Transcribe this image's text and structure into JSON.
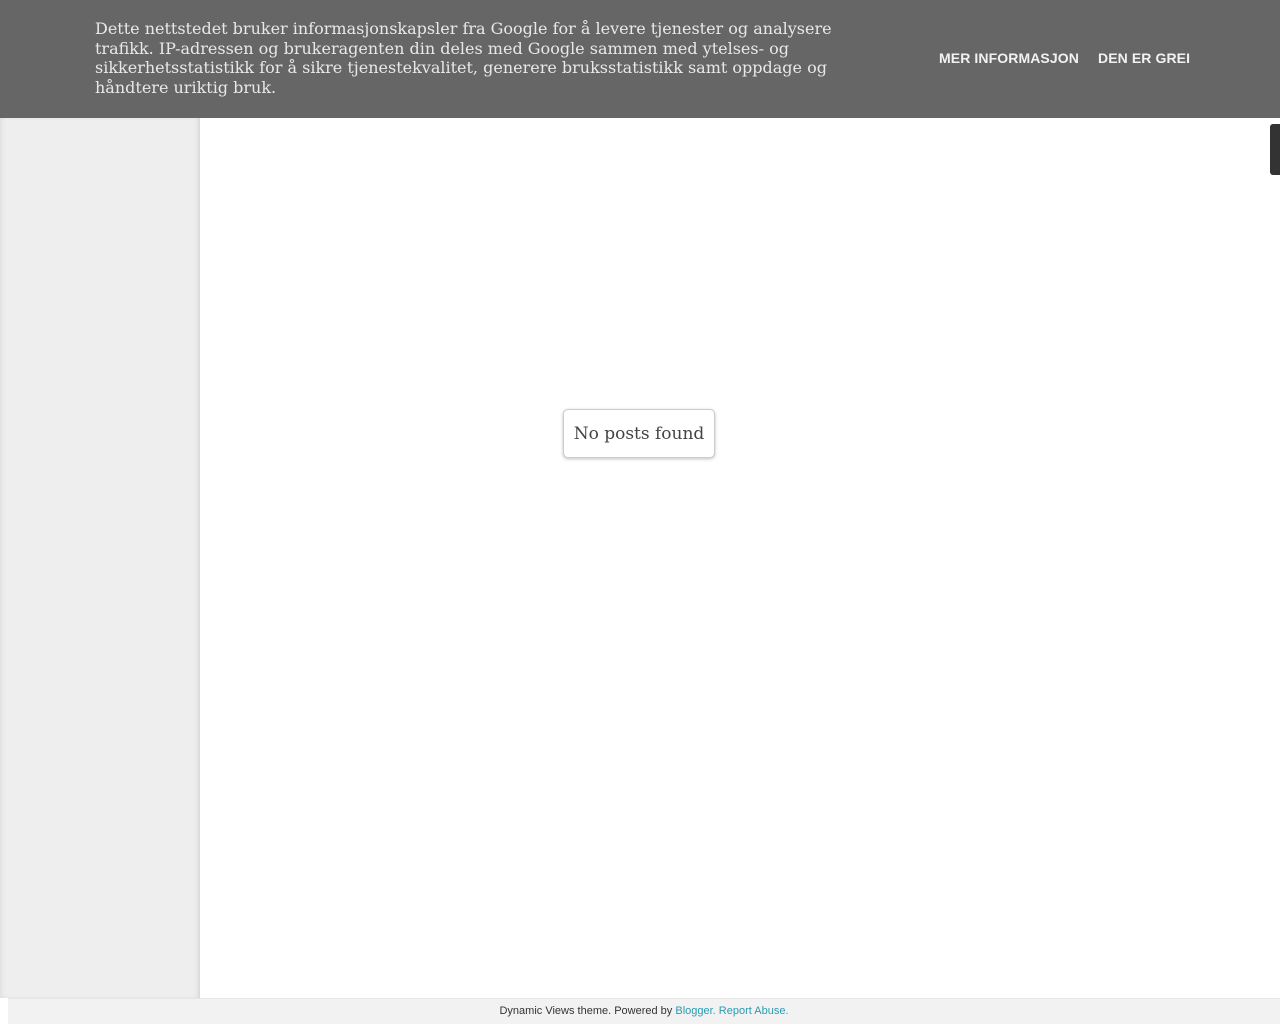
{
  "cookie_banner": {
    "message": "Dette nettstedet bruker informasjonskapsler fra Google for å levere tjenester og analysere trafikk. IP-adressen og brukeragenten din deles med Google sammen med ytelses- og sikkerhetsstatistikk for å sikre tjenestekvalitet, generere bruksstatistikk samt oppdage og håndtere uriktig bruk.",
    "more_info_label": "MER INFORMASJON",
    "accept_label": "DEN ER GREI",
    "background_color": "#666666"
  },
  "main": {
    "empty_message": "No posts found"
  },
  "footer": {
    "prefix": "Dynamic Views theme. Powered by ",
    "blogger_link": "Blogger",
    "separator": ". ",
    "report_link": "Report Abuse",
    "suffix": ".",
    "link_color": "#2a9bb0"
  }
}
